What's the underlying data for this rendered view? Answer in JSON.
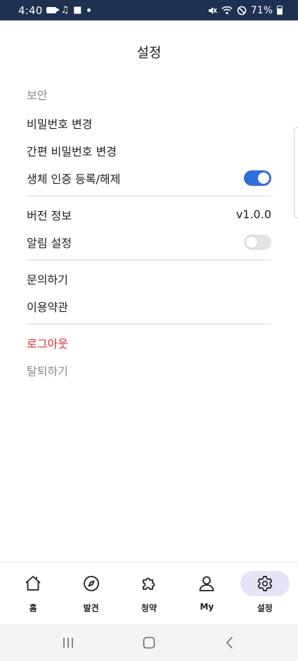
{
  "status_bar": {
    "time": "4:40",
    "battery": "71%"
  },
  "header": {
    "title": "설정"
  },
  "settings": {
    "section_security": "보안",
    "change_password": "비밀번호 변경",
    "change_simple_password": "간편 비밀번호 변경",
    "biometric": "생체 인증 등록/해제",
    "biometric_on": true,
    "version_label": "버전 정보",
    "version_value": "v1.0.0",
    "notification": "알림 설정",
    "notification_on": false,
    "inquiry": "문의하기",
    "terms": "이용약관",
    "logout": "로그아웃",
    "withdraw": "탈퇴하기"
  },
  "bottom_nav": {
    "items": [
      {
        "label": "홈",
        "icon": "home-icon"
      },
      {
        "label": "발견",
        "icon": "compass-icon"
      },
      {
        "label": "청약",
        "icon": "puzzle-icon"
      },
      {
        "label": "My",
        "icon": "user-icon"
      },
      {
        "label": "설정",
        "icon": "gear-icon",
        "active": true
      }
    ]
  },
  "colors": {
    "status_bar_bg": "#1f3150",
    "toggle_on": "#2f6fdb",
    "logout": "#e0282a",
    "nav_active_bg": "#e8e2f7"
  }
}
